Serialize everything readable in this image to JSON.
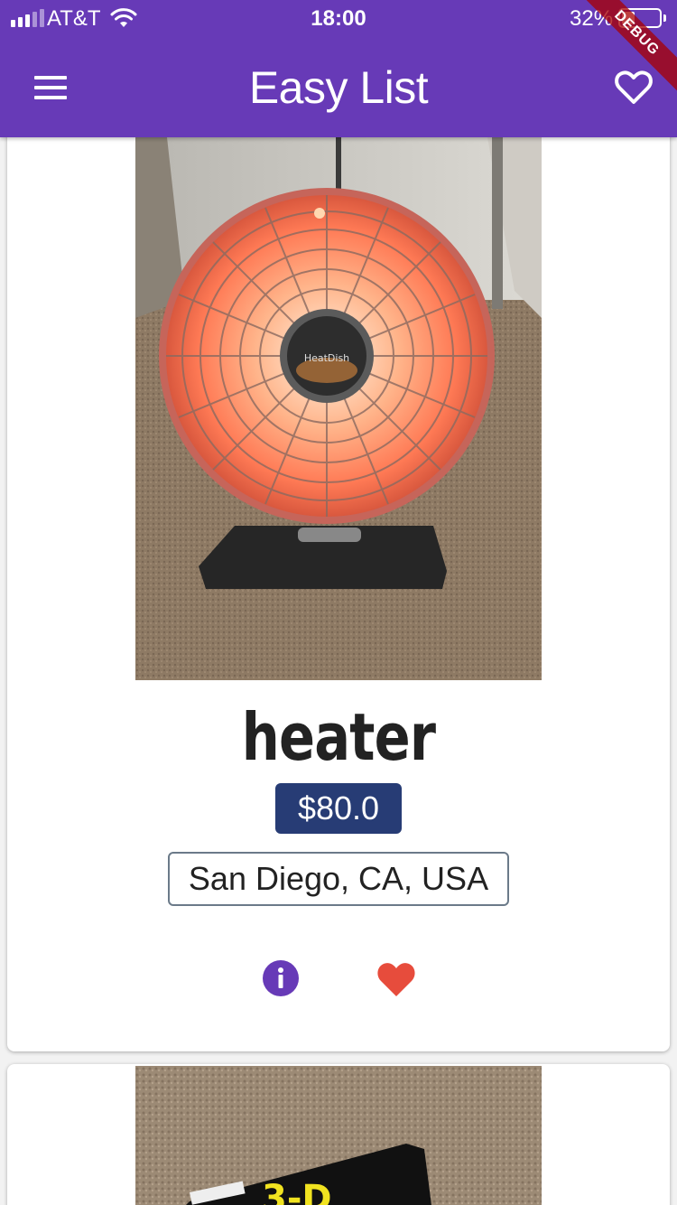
{
  "status": {
    "carrier": "AT&T",
    "time": "18:00",
    "battery": "32%",
    "battery_level": 0.32
  },
  "app": {
    "title": "Easy List",
    "debug_label": "DEBUG"
  },
  "products": [
    {
      "title": "heater",
      "price": "$80.0",
      "location": "San Diego, CA, USA"
    },
    {
      "image_text": "3-D"
    }
  ],
  "colors": {
    "primary": "#673ab7",
    "price_bg": "#273c75",
    "favorite": "#e74c3c",
    "info": "#673ab7"
  },
  "icons": [
    "menu-icon",
    "heart-outline-icon",
    "info-icon",
    "heart-filled-icon",
    "wifi-icon",
    "battery-icon"
  ]
}
